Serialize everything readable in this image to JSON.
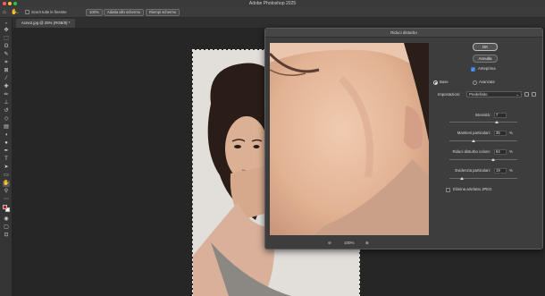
{
  "app": {
    "title": "Adobe Photoshop 2025"
  },
  "options_bar": {
    "scroll_all_label": "Scorri tutte le finestre",
    "zoom_100_label": "100%",
    "fit_screen_label": "Adatta allo schermo",
    "fill_screen_label": "Riempi schermo"
  },
  "document": {
    "tab_label": "Acne2.jpg @ 25% (RGB/8) *"
  },
  "toolbar": {
    "foreground_color": "#c41818",
    "background_color": "#ffffff"
  },
  "dialog": {
    "title": "Riduci disturbo",
    "ok_label": "OK",
    "cancel_label": "Annulla",
    "preview_label": "Anteprima",
    "preview_checked": true,
    "mode_basic_label": "Base",
    "mode_advanced_label": "Avanzate",
    "mode_selected": "Base",
    "settings_label": "Impostazioni:",
    "settings_value": "Predefinito",
    "zoom_level": "100%",
    "zoom_out_icon": "zoom-out-icon",
    "zoom_in_icon": "zoom-in-icon",
    "sliders": [
      {
        "label": "Intensità:",
        "value": "7",
        "unit": "",
        "fraction": 0.7
      },
      {
        "label": "Mantieni particolari:",
        "value": "35",
        "unit": "%",
        "fraction": 0.35
      },
      {
        "label": "Riduci disturbo colore:",
        "value": "64",
        "unit": "%",
        "fraction": 0.64
      },
      {
        "label": "Evidenzia particolari:",
        "value": "19",
        "unit": "%",
        "fraction": 0.19
      }
    ],
    "jpeg_artifact_label": "Elimina artefatto JPEG",
    "jpeg_artifact_checked": false
  }
}
